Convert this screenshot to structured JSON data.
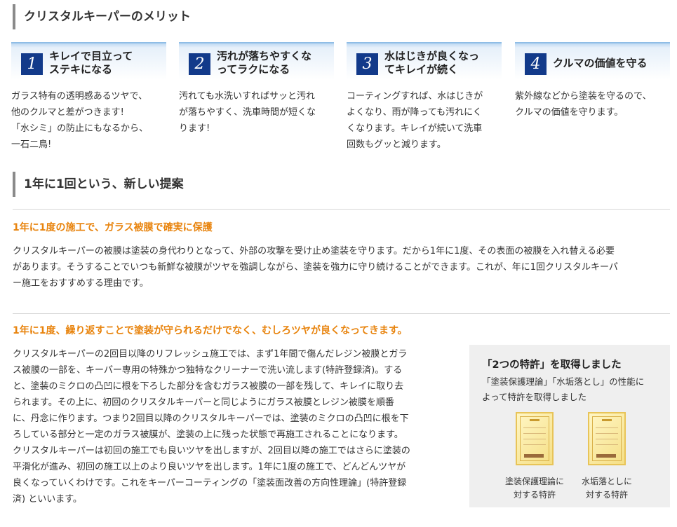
{
  "section1": {
    "title": "クリスタルキーパーのメリット",
    "features": [
      {
        "number": "1",
        "title": "キレイで目立って\nステキになる",
        "body": "ガラス特有の透明感あるツヤで、\n他のクルマと差がつきます!\n「水シミ」の防止にもなるから、\n一石二鳥!"
      },
      {
        "number": "2",
        "title": "汚れが落ちやすくな\nってラクになる",
        "body": "汚れても水洗いすればサッと汚れ\nが落ちやすく、洗車時間が短くな\nります!"
      },
      {
        "number": "3",
        "title": "水はじきが良くなっ\nてキレイが続く",
        "body": "コーティングすれば、水はじきが\nよくなり、雨が降っても汚れにく\nくなります。キレイが続いて洗車\n回数もグッと減ります。"
      },
      {
        "number": "4",
        "title": "クルマの価値を守る",
        "body": "紫外線などから塗装を守るので、\nクルマの価値を守ります。"
      }
    ]
  },
  "section2": {
    "title": "1年に1回という、新しい提案",
    "block1": {
      "heading": "1年に1度の施工で、ガラス被膜で確実に保護",
      "text": "クリスタルキーパーの被膜は塗装の身代わりとなって、外部の攻撃を受け止め塗装を守ります。だから1年に1度、その表面の被膜を入れ替える必要\nがあります。そうすることでいつも新鮮な被膜がツヤを強調しながら、塗装を強力に守り続けることができます。これが、年に1回クリスタルキーパ\nー施工をおすすめする理由です。"
    },
    "block2": {
      "heading": "1年に1度、繰り返すことで塗装が守られるだけでなく、むしろツヤが良くなってきます。",
      "text": "クリスタルキーパーの2回目以降のリフレッシュ施工では、まず1年間で傷んだレジン被膜とガラ\nス被膜の一部を、キーパー専用の特殊かつ独特なクリーナーで洗い流します(特許登録済)。する\nと、塗装のミクロの凸凹に根を下ろした部分を含むガラス被膜の一部を残して、キレイに取り去\nられます。その上に、初回のクリスタルキーパーと同じようにガラス被膜とレジン被膜を順番\nに、丹念に作ります。つまり2回目以降のクリスタルキーパーでは、塗装のミクロの凸凹に根を下\nろしている部分と一定のガラス被膜が、塗装の上に残った状態で再施工されることになります。\nクリスタルキーパーは初回の施工でも良いツヤを出しますが、2回目以降の施工ではさらに塗装の\n平滑化が進み、初回の施工以上のより良いツヤを出します。1年に1度の施工で、どんどんツヤが\n良くなっていくわけです。これをキーパーコーティングの「塗装面改善の方向性理論」(特許登録\n済) といいます。"
    },
    "patent": {
      "title": "「2つの特許」を取得しました",
      "text": "「塗装保護理論」「水垢落とし」の性能に\nよって特許を取得しました",
      "certificates": [
        {
          "caption": "塗装保護理論に\n対する特許"
        },
        {
          "caption": "水垢落としに\n対する特許"
        }
      ]
    }
  }
}
